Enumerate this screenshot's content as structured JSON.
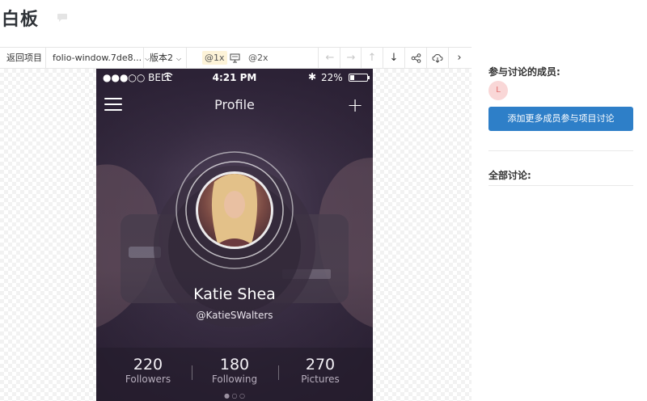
{
  "page": {
    "title": "白板"
  },
  "toolbar": {
    "back_label": "返回项目",
    "file_name": "folio-window.7de8...",
    "version_label": "版本2",
    "scale_1x": "@1x",
    "scale_2x": "@2x"
  },
  "phone": {
    "status": {
      "carrier": "●●●○○ BELL",
      "time": "4:21 PM",
      "battery": "22%"
    },
    "nav_title": "Profile",
    "profile": {
      "name": "Katie Shea",
      "handle": "@KatieSWalters"
    },
    "stats": [
      {
        "value": "220",
        "label": "Followers"
      },
      {
        "value": "180",
        "label": "Following"
      },
      {
        "value": "270",
        "label": "Pictures"
      }
    ]
  },
  "sidebar": {
    "members_heading": "参与讨论的成员:",
    "member_initial": "L",
    "add_button": "添加更多成员参与项目讨论",
    "all_heading": "全部讨论:"
  },
  "colors": {
    "accent_button": "#2e7fc8",
    "member_avatar_bg": "#f9d7d7",
    "scale_tag_bg": "#fdf3d8"
  }
}
